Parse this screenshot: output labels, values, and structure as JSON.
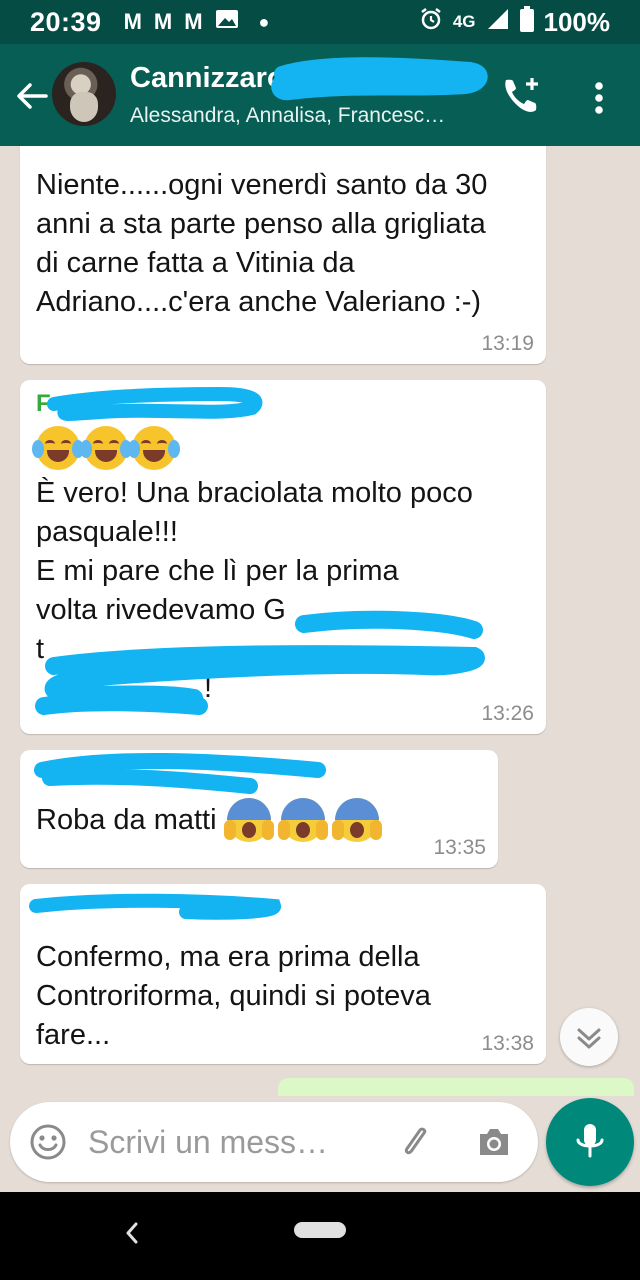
{
  "status_bar": {
    "time": "20:39",
    "notification_icons": [
      "gmail-icon",
      "gmail-icon",
      "gmail-icon",
      "image-icon",
      "dot"
    ],
    "network": "4G",
    "battery": "100%"
  },
  "header": {
    "title": "Cannizzaro",
    "subtitle": "Alessandra, Annalisa, Francesc…",
    "back_icon": "arrow-left-icon",
    "call_icon": "add-call-icon",
    "more_icon": "more-vertical-icon"
  },
  "messages": [
    {
      "sender": "",
      "text": "Niente......ogni venerdì santo da 30 anni a sta parte penso alla grigliata di carne fatta a Vitinia da Adriano....c'era anche Valeriano :-)",
      "time": "13:19"
    },
    {
      "sender": "F",
      "emoji": "😂😂😂",
      "text_line1": "È vero! Una braciolata molto poco pasquale!!!",
      "text_line2": "E mi pare che lì per la prima volta rivedevamo G",
      "text_line3": "t",
      "text_line4": "!",
      "time": "13:26"
    },
    {
      "sender": "",
      "text": "Roba da matti",
      "emoji": "😱😱😱",
      "time": "13:35"
    },
    {
      "sender": "",
      "text": "Confermo, ma era prima della Controriforma, quindi si poteva fare...",
      "time": "13:38"
    }
  ],
  "composer": {
    "placeholder": "Scrivi un mess…",
    "emoji_icon": "smiley-icon",
    "attach_icon": "paperclip-icon",
    "camera_icon": "camera-icon",
    "send_icon": "microphone-icon"
  },
  "colors": {
    "status_bar": "#054d44",
    "app_bar": "#075e54",
    "chat_bg": "#e5ddd5",
    "accent": "#00897b",
    "sender_green": "#35a83e",
    "redaction": "#14b4f2"
  }
}
